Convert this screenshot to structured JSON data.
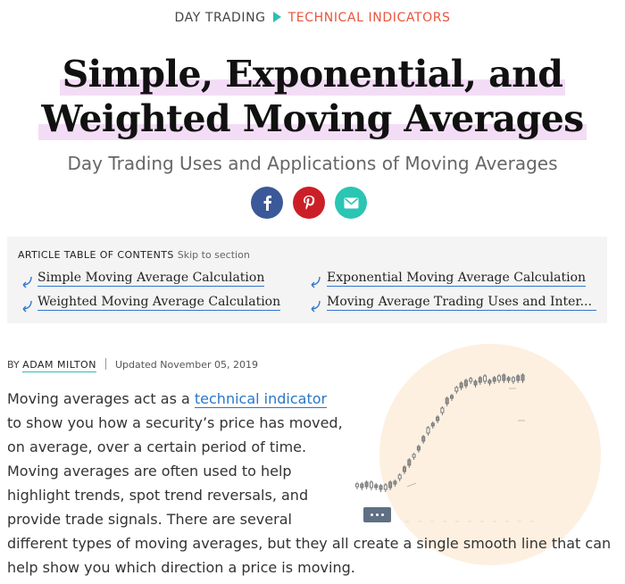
{
  "breadcrumb": {
    "parent": "DAY TRADING",
    "current": "TECHNICAL INDICATORS"
  },
  "title": {
    "line1": "Simple, Exponential, and",
    "line2": "Weighted Moving Averages"
  },
  "subtitle": "Day Trading Uses and Applications of Moving Averages",
  "social": {
    "icons": [
      "facebook-icon",
      "pinterest-icon",
      "email-icon"
    ]
  },
  "toc": {
    "heading": "ARTICLE TABLE OF CONTENTS",
    "skip_label": "Skip to section",
    "items": [
      "Simple Moving Average Calculation",
      "Exponential Moving Average Calculation",
      "Weighted Moving Average Calculation",
      "Moving Average Trading Uses and Inter..."
    ]
  },
  "byline": {
    "by": "BY",
    "author": "ADAM MILTON",
    "updated": "Updated November 05, 2019"
  },
  "article": {
    "p1_prefix": "Moving averages act as a ",
    "p1_link": "technical indicator",
    "lines": [
      "to show you how a security’s price has moved,",
      "on average, over a certain period of time.",
      "Moving averages are often used to help",
      "highlight trends, spot trend reversals, and",
      "provide trade signals. There are several",
      "different types of moving averages, but they all create a single smooth line that can",
      "help show you which direction a price is moving."
    ]
  },
  "colors": {
    "accent_teal": "#2bbfb0",
    "accent_orange": "#e8553e",
    "link_blue": "#2a77c9",
    "facebook": "#3b5998",
    "pinterest": "#cb1f27",
    "email": "#2bc5b4"
  }
}
